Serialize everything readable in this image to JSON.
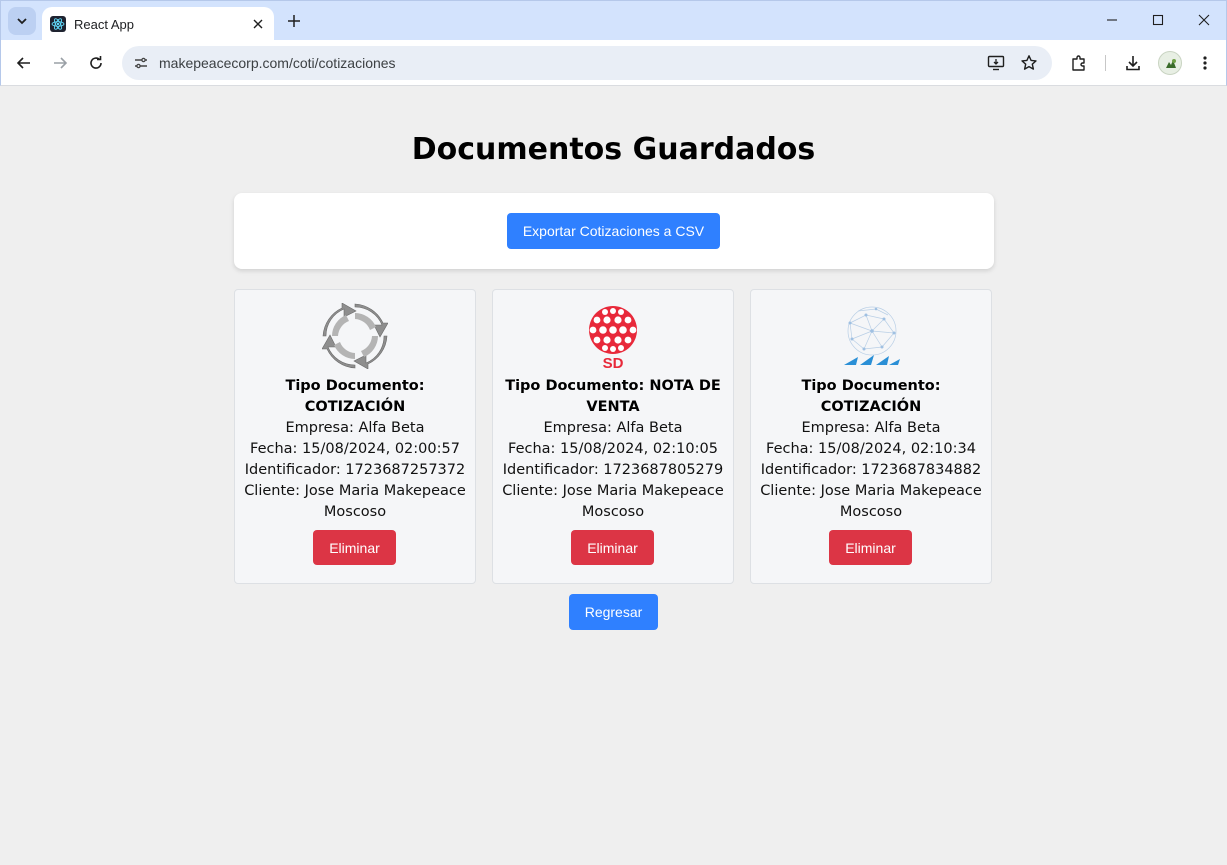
{
  "browser": {
    "tab_title": "React App",
    "url": "makepeacecorp.com/coti/cotizaciones"
  },
  "page": {
    "title": "Documentos Guardados",
    "export_label": "Exportar Cotizaciones a CSV",
    "back_label": "Regresar"
  },
  "cards": [
    {
      "type": "Tipo Documento: COTIZACIÓN",
      "empresa": "Empresa: Alfa Beta",
      "fecha": "Fecha: 15/08/2024, 02:00:57",
      "identificador": "Identificador: 1723687257372",
      "cliente": "Cliente: Jose Maria Makepeace Moscoso",
      "delete_label": "Eliminar",
      "logo": "gray-circular-arrows-logo"
    },
    {
      "type": "Tipo Documento: NOTA DE VENTA",
      "empresa": "Empresa: Alfa Beta",
      "fecha": "Fecha: 15/08/2024, 02:10:05",
      "identificador": "Identificador: 1723687805279",
      "cliente": "Cliente: Jose Maria Makepeace Moscoso",
      "delete_label": "Eliminar",
      "logo": "red-dotted-sphere-sd-logo",
      "logo_text": "SD"
    },
    {
      "type": "Tipo Documento: COTIZACIÓN",
      "empresa": "Empresa: Alfa Beta",
      "fecha": "Fecha: 15/08/2024, 02:10:34",
      "identificador": "Identificador: 1723687834882",
      "cliente": "Cliente: Jose Maria Makepeace Moscoso",
      "delete_label": "Eliminar",
      "logo": "blue-network-globe-logo"
    }
  ],
  "colors": {
    "primary": "#2f80ff",
    "danger": "#dc3545",
    "page_bg": "#efefef",
    "tabbar_bg": "#d3e3fd"
  }
}
